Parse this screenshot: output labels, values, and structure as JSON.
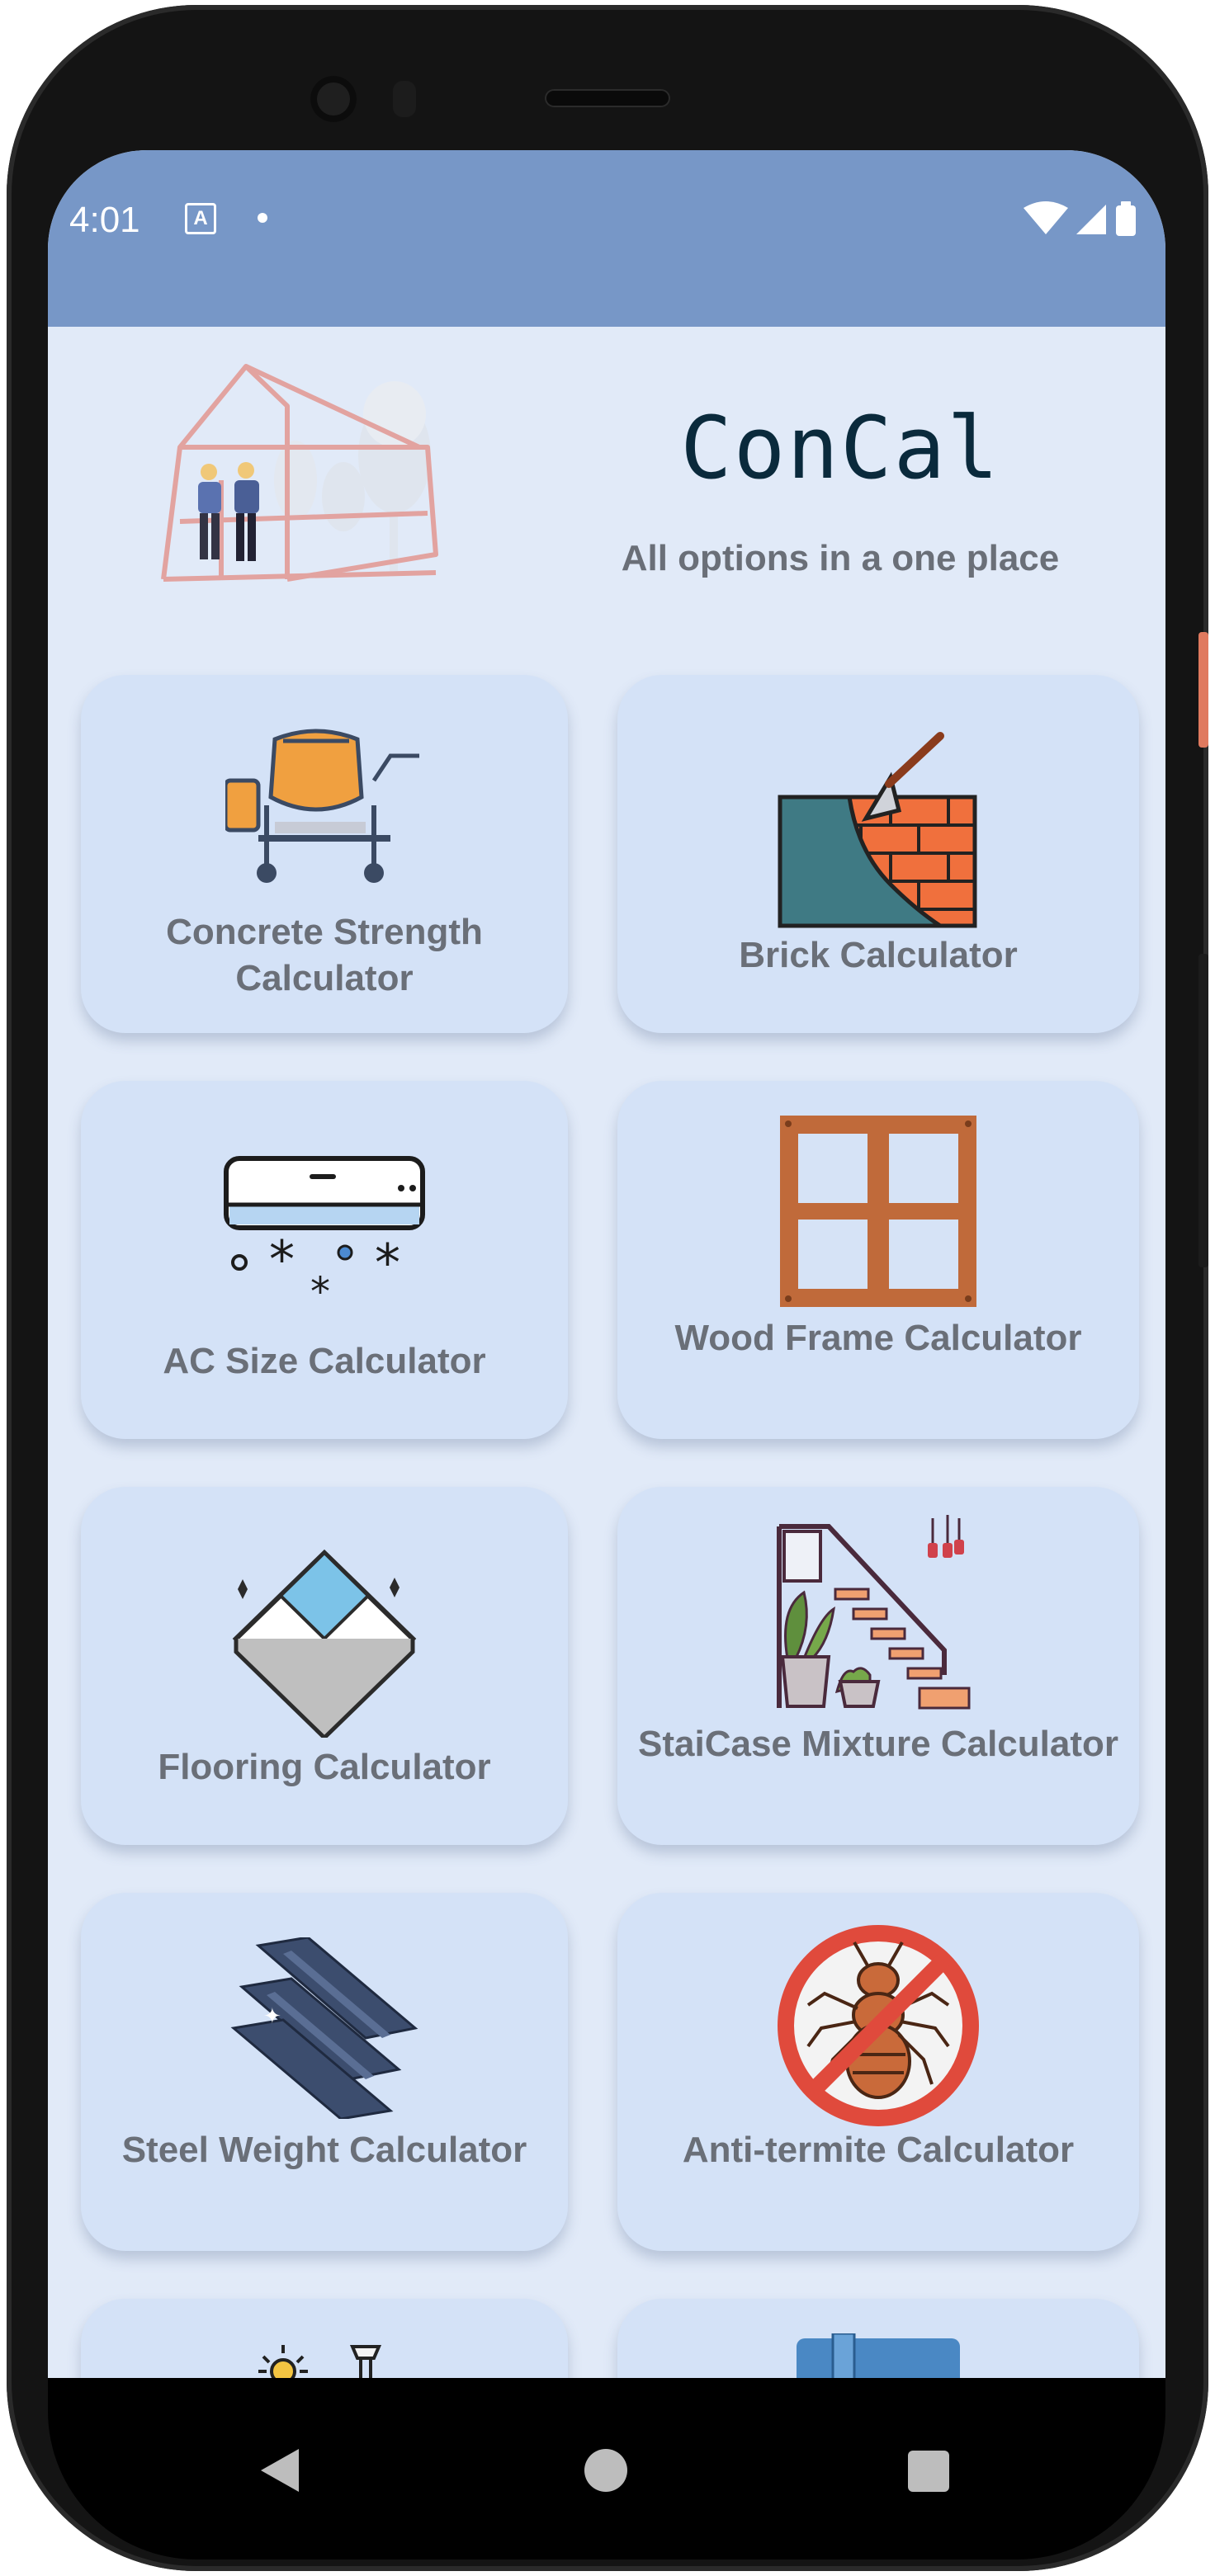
{
  "status_bar": {
    "time": "4:01",
    "notification_icon": "A",
    "icons": [
      "wifi-icon",
      "signal-icon",
      "battery-icon"
    ]
  },
  "header": {
    "title": "ConCal",
    "subtitle": "All options in a one place"
  },
  "cards": [
    {
      "label": "Concrete Strength Calculator",
      "icon": "concrete-mixer-icon"
    },
    {
      "label": "Brick Calculator",
      "icon": "brick-wall-icon"
    },
    {
      "label": "AC Size Calculator",
      "icon": "air-conditioner-icon"
    },
    {
      "label": "Wood Frame Calculator",
      "icon": "wood-frame-icon"
    },
    {
      "label": "Flooring Calculator",
      "icon": "floor-tile-icon"
    },
    {
      "label": "StaiCase Mixture Calculator",
      "icon": "staircase-icon"
    },
    {
      "label": "Steel Weight Calculator",
      "icon": "steel-beam-icon"
    },
    {
      "label": "Anti-termite Calculator",
      "icon": "no-termite-icon"
    }
  ],
  "colors": {
    "status_bar": "#7797c7",
    "background": "#e1eaf8",
    "card": "#d4e2f7",
    "label": "#6a6f78",
    "title": "#0a2a3c"
  }
}
